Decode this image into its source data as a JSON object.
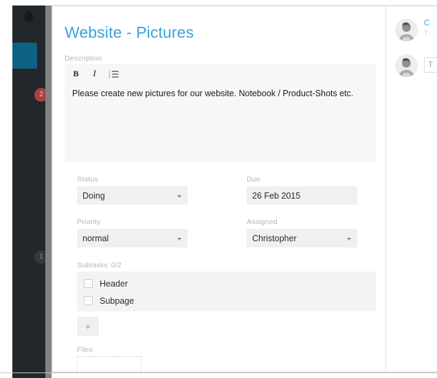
{
  "sidebar": {
    "bell_icon": "bell-icon",
    "active_item": "board-nav-active",
    "badges": [
      {
        "name": "alerts",
        "value": "2",
        "color": "#a8413f"
      },
      {
        "name": "messages",
        "value": "1",
        "color": "#32383d"
      }
    ]
  },
  "card": {
    "title": "Website - Pictures",
    "title_color": "#3ba2dd"
  },
  "description": {
    "label": "Description",
    "toolbar": [
      {
        "name": "bold-icon",
        "label": "B"
      },
      {
        "name": "italic-icon",
        "label": "I"
      },
      {
        "name": "ordered-list-icon",
        "label": ""
      }
    ],
    "text": "Please create new pictures for our website. Notebook / Product-Shots etc."
  },
  "fields": {
    "status": {
      "label": "Status",
      "value": "Doing",
      "options": [
        "Doing"
      ]
    },
    "due": {
      "label": "Due",
      "value": "26 Feb 2015"
    },
    "priority": {
      "label": "Priority",
      "value": "normal",
      "options": [
        "normal"
      ]
    },
    "assigned": {
      "label": "Assigned",
      "value": "Christopher",
      "options": [
        "Christopher"
      ]
    }
  },
  "subtasks": {
    "label": "Subtasks",
    "count": "0/2",
    "add_label": "+",
    "items": [
      {
        "label": "Header",
        "checked": false
      },
      {
        "label": "Subpage",
        "checked": false
      }
    ]
  },
  "files": {
    "label": "Files"
  },
  "comments": {
    "entries": [
      {
        "avatar": "user-avatar",
        "author": "C",
        "time": "7"
      },
      {
        "avatar": "user-avatar",
        "input_placeholder": "T"
      }
    ]
  }
}
